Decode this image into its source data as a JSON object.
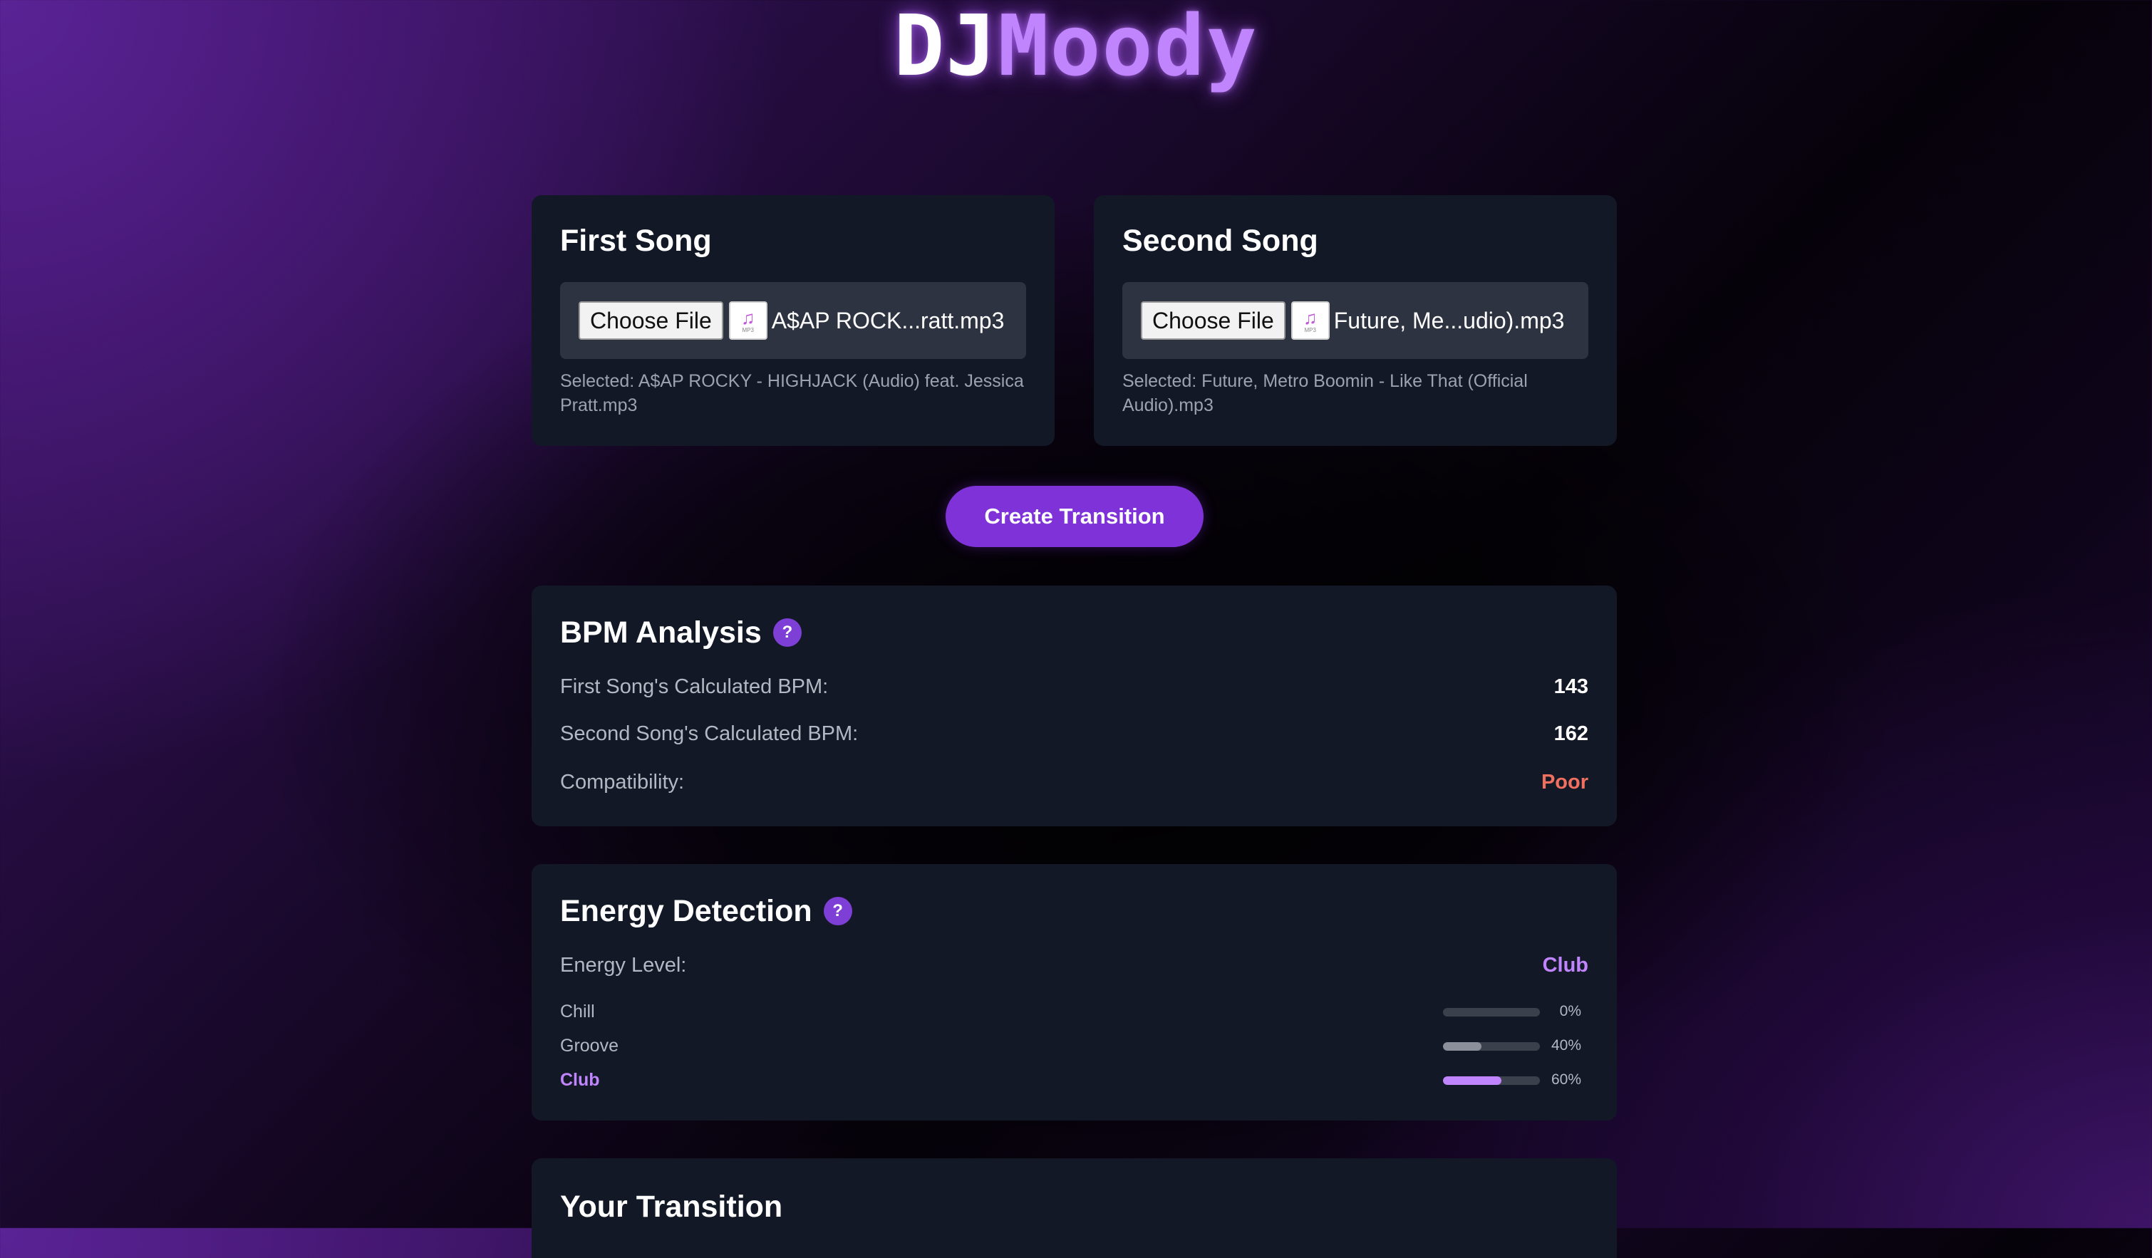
{
  "logo": {
    "part1": "DJ",
    "part2": "Moody"
  },
  "songs": [
    {
      "title": "First Song",
      "choose_label": "Choose File",
      "file_display": "A$AP ROCK...ratt.mp3",
      "selected_text": "Selected: A$AP ROCKY - HIGHJACK (Audio) feat. Jessica Pratt.mp3",
      "file_icon_ext": "MP3"
    },
    {
      "title": "Second Song",
      "choose_label": "Choose File",
      "file_display": "Future, Me...udio).mp3",
      "selected_text": "Selected: Future, Metro Boomin - Like That (Official Audio).mp3",
      "file_icon_ext": "MP3"
    }
  ],
  "create_button": "Create Transition",
  "bpm": {
    "title": "BPM Analysis",
    "help": "?",
    "rows": [
      {
        "label": "First Song's Calculated BPM:",
        "value": "143"
      },
      {
        "label": "Second Song's Calculated BPM:",
        "value": "162"
      },
      {
        "label": "Compatibility:",
        "value": "Poor"
      }
    ]
  },
  "energy": {
    "title": "Energy Detection",
    "help": "?",
    "level_label": "Energy Level:",
    "level_value": "Club",
    "levels": [
      {
        "name": "Chill",
        "percent": 0,
        "percent_label": "0%",
        "active": false
      },
      {
        "name": "Groove",
        "percent": 40,
        "percent_label": "40%",
        "active": false
      },
      {
        "name": "Club",
        "percent": 60,
        "percent_label": "60%",
        "active": true
      }
    ]
  },
  "transition": {
    "title": "Your Transition"
  },
  "colors": {
    "accent": "#7e32d8",
    "accent_light": "#c084fc",
    "poor": "#f07060",
    "card_bg": "#121826",
    "bar_inactive": "#8a8f99"
  },
  "icons": {
    "help": "question-circle-icon",
    "file": "music-file-icon"
  }
}
